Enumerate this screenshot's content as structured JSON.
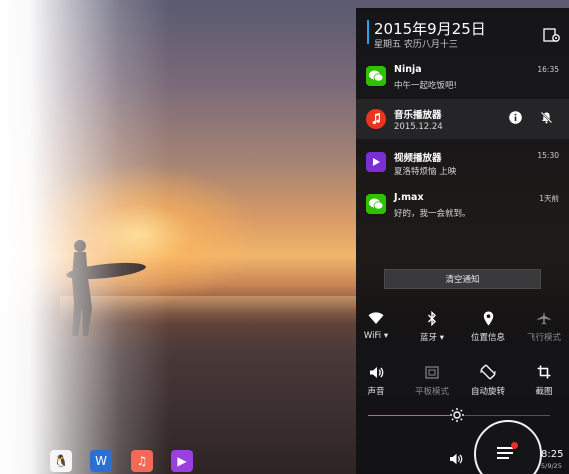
{
  "notification_panel": {
    "date": "2015年9月25日",
    "lunar_date": "星期五 农历八月十三",
    "settings_icon": "settings-gear-icon",
    "accent_color": "#2aa3e8",
    "notifications": [
      {
        "app": "wechat",
        "title": "Ninja",
        "body": "中午一起吃饭吧!",
        "time": "16:35",
        "icon": "wechat-icon",
        "icon_color": "#2dc100"
      },
      {
        "app": "music-player",
        "title": "音乐播放器",
        "body": "2015.12.24",
        "time": "",
        "icon": "music-note-icon",
        "icon_color": "#e8361f",
        "actions": [
          "info-icon",
          "mute-bell-icon"
        ]
      },
      {
        "app": "video-player",
        "title": "视频播放器",
        "body": "夏洛特烦恼 上映",
        "time": "15:30",
        "icon": "play-icon",
        "icon_color": "#7b2fd3"
      },
      {
        "app": "wechat",
        "title": "J.max",
        "body": "好的，我一会就到。",
        "time": "1天前",
        "icon": "wechat-icon",
        "icon_color": "#2dc100"
      }
    ],
    "clear_label": "清空通知",
    "quick_settings_row1": [
      {
        "label": "WiFi ▾",
        "icon": "wifi-icon",
        "active": true
      },
      {
        "label": "蓝牙 ▾",
        "icon": "bluetooth-icon",
        "active": true
      },
      {
        "label": "位置信息",
        "icon": "location-pin-icon",
        "active": true
      },
      {
        "label": "飞行模式",
        "icon": "airplane-icon",
        "active": false
      }
    ],
    "quick_settings_row2": [
      {
        "label": "声音",
        "icon": "speaker-icon",
        "active": true
      },
      {
        "label": "平板模式",
        "icon": "tablet-mode-icon",
        "active": false
      },
      {
        "label": "自动旋转",
        "icon": "rotate-icon",
        "active": true
      },
      {
        "label": "截图",
        "icon": "crop-icon",
        "active": true
      }
    ],
    "brightness": {
      "icon": "brightness-sun-icon",
      "level": 0.49
    }
  },
  "taskbar": {
    "apps": [
      {
        "name": "qq",
        "icon": "qq-penguin-icon",
        "color": "#f6f6f6",
        "glyph": "🐧"
      },
      {
        "name": "word",
        "icon": "word-document-icon",
        "color": "#2b6fd1",
        "glyph": "W"
      },
      {
        "name": "music",
        "icon": "music-note-icon",
        "color": "#f26a55",
        "glyph": "♫"
      },
      {
        "name": "video",
        "icon": "play-icon",
        "color": "#9a3fe0",
        "glyph": "▶"
      }
    ],
    "volume_icon": "volume-icon",
    "launcher_icon": "menu-list-icon",
    "clock_time": "8:25",
    "clock_date": "5/9/25"
  }
}
